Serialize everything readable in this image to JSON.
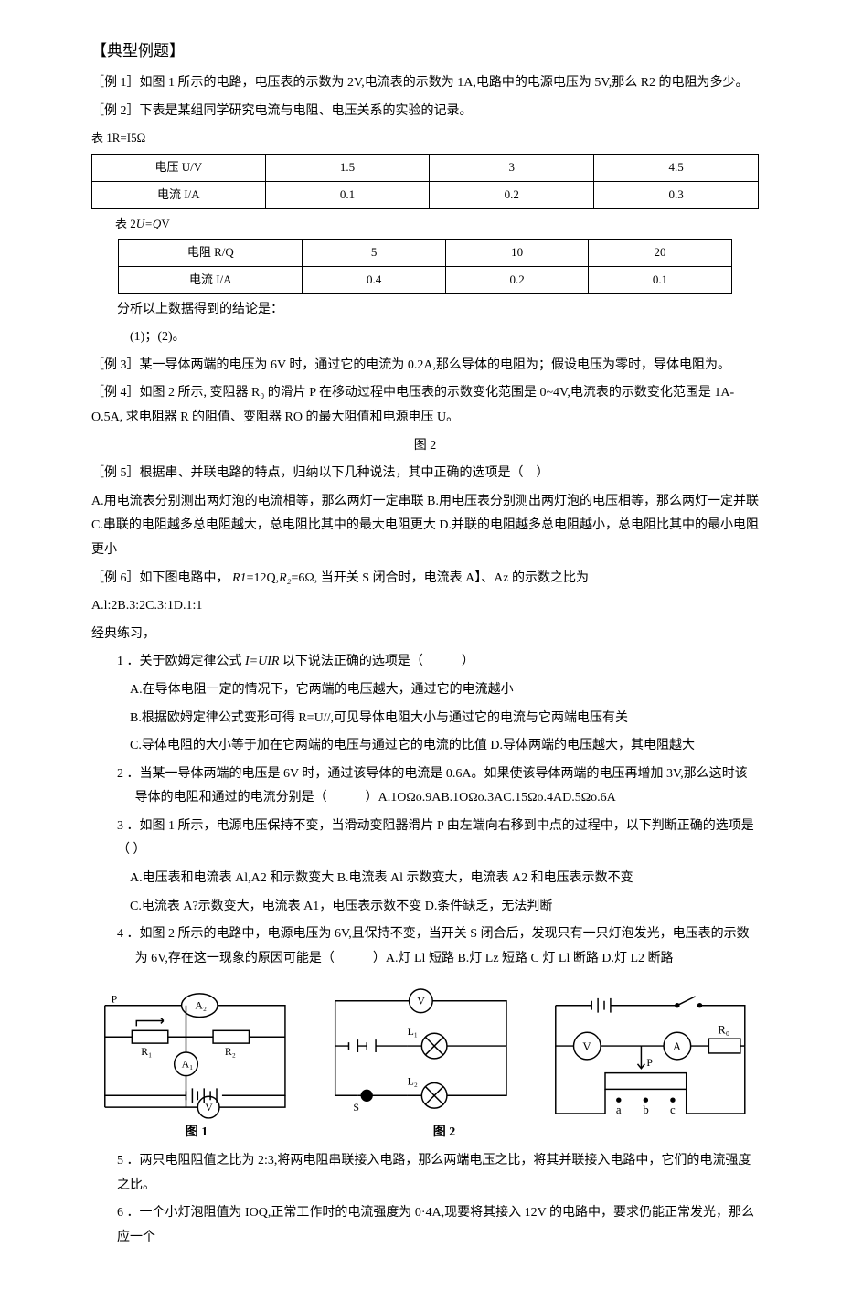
{
  "heading": "【典型例题】",
  "ex1": "［例 1］如图 1 所示的电路，电压表的示数为 2V,电流表的示数为 1A,电路中的电源电压为 5V,那么 R2 的电阻为多少。",
  "ex2": "［例 2］下表是某组同学研究电流与电阻、电压关系的实验的记录。",
  "table1_caption": "表 1R=I5Ω",
  "table1": {
    "r1": [
      "电压 U/V",
      "1.5",
      "3",
      "4.5"
    ],
    "r2": [
      "电流 I/A",
      "0.1",
      "0.2",
      "0.3"
    ]
  },
  "table2_caption": "表 2U=QV",
  "table2": {
    "r1": [
      "电阻 R/Q",
      "5",
      "10",
      "20"
    ],
    "r2": [
      "电流 I/A",
      "0.4",
      "0.2",
      "0.1"
    ]
  },
  "analysis": "分析以上数据得到的结论是：",
  "blanks": "(1)；(2)。",
  "ex3": "［例 3］某一导体两端的电压为 6V 时，通过它的电流为 0.2A,那么导体的电阻为；假设电压为零时，导体电阻为。",
  "ex4": "［例 4］如图 2 所示, 变阻器 R₀ 的滑片 P 在移动过程中电压表的示数变化范围是 0~4V,电流表的示数变化范围是 1A-O.5A, 求电阻器 R 的阻值、变阻器 RO 的最大阻值和电源电压 U。",
  "fig2_text": "图 2",
  "ex5": "［例 5］根据串、并联电路的特点，归纳以下几种说法，其中正确的选项是（　）",
  "ex5_opts": "A.用电流表分别测出两灯泡的电流相等，那么两灯一定串联 B.用电压表分别测出两灯泡的电压相等，那么两灯一定并联 C.串联的电阻越多总电阻越大，总电阻比其中的最大电阻更大 D.并联的电阻越多总电阻越小，总电阻比其中的最小电阻更小",
  "ex6_a": "［例 6］如下图电路中，",
  "ex6_b": "=12Q,",
  "ex6_c": "=6Ω, 当开关 S 闭合时，电流表 A】、Az 的示数之比为",
  "ex6_opts": "A.l:2B.3:2C.3:1D.1:1",
  "practice_title": "经典练习，",
  "q1": "1 ．关于欧姆定律公式 I=UIR 以下说法正确的选项是（　　　）",
  "q1a": "A.在导体电阻一定的情况下，它两端的电压越大，通过它的电流越小",
  "q1b": "B.根据欧姆定律公式变形可得 R=U//,可见导体电阻大小与通过它的电流与它两端电压有关",
  "q1c": "C.导体电阻的大小等于加在它两端的电压与通过它的电流的比值 D.导体两端的电压越大，其电阻越大",
  "q2": "2 ．当某一导体两端的电压是 6V 时，通过该导体的电流是 0.6A。如果使该导体两端的电压再增加 3V,那么这时该导体的电阻和通过的电流分别是（　　　）A.1OΩo.9AB.1OΩo.3AC.15Ωo.4AD.5Ωo.6A",
  "q3": "3 ．如图 1 所示，电源电压保持不变，当滑动变阻器滑片 P 由左端向右移到中点的过程中，以下判断正确的选项是（ ）",
  "q3a": "A.电压表和电流表 Al,A2 和示数变大 B.电流表 Al 示数变大，电流表 A2 和电压表示数不变",
  "q3b": "C.电流表 A?示数变大，电流表 A1，电压表示数不变 D.条件缺乏，无法判断",
  "q4": "4 ．如图 2 所示的电路中，电源电压为 6V,且保持不变，当开关 S 闭合后，发现只有一只灯泡发光，电压表的示数为 6V,存在这一现象的原因可能是（　　　）A.灯 Ll 短路 B.灯 Lz 短路 C 灯 Ll 断路 D.灯 L2 断路",
  "fig1_label": "图 1",
  "fig2_label": "图 2",
  "q5": "5 ．两只电阻阻值之比为 2:3,将两电阻串联接入电路，那么两端电压之比，将其并联接入电路中，它们的电流强度之比。",
  "q6": "6 ．一个小灯泡阻值为 IOQ,正常工作时的电流强度为 0·4A,现要将其接入 12V 的电路中，要求仍能正常发光，那么应一个"
}
